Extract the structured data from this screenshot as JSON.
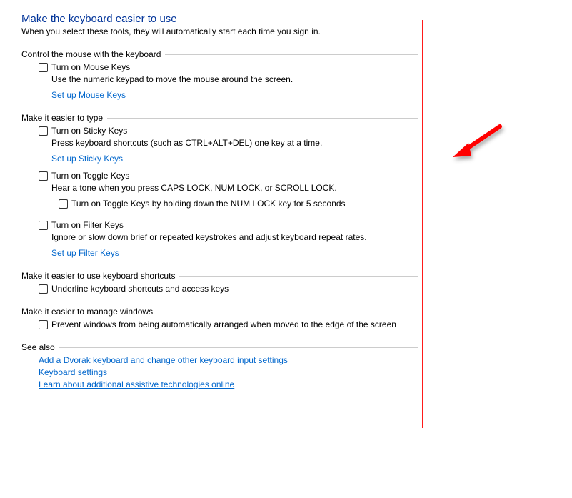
{
  "page": {
    "title": "Make the keyboard easier to use",
    "subtitle": "When you select these tools, they will automatically start each time you sign in."
  },
  "sections": {
    "mouse": {
      "header": "Control the mouse with the keyboard",
      "mouse_keys_label": "Turn on Mouse Keys",
      "mouse_keys_desc": "Use the numeric keypad to move the mouse around the screen.",
      "mouse_keys_link": "Set up Mouse Keys"
    },
    "type": {
      "header": "Make it easier to type",
      "sticky_label": "Turn on Sticky Keys",
      "sticky_desc": "Press keyboard shortcuts (such as CTRL+ALT+DEL) one key at a time.",
      "sticky_link": "Set up Sticky Keys",
      "toggle_label": "Turn on Toggle Keys",
      "toggle_desc": "Hear a tone when you press CAPS LOCK, NUM LOCK, or SCROLL LOCK.",
      "toggle_hold_label": "Turn on Toggle Keys by holding down the NUM LOCK key for 5 seconds",
      "filter_label": "Turn on Filter Keys",
      "filter_desc": "Ignore or slow down brief or repeated keystrokes and adjust keyboard repeat rates.",
      "filter_link": "Set up Filter Keys"
    },
    "shortcuts": {
      "header": "Make it easier to use keyboard shortcuts",
      "underline_label": "Underline keyboard shortcuts and access keys"
    },
    "windows": {
      "header": "Make it easier to manage windows",
      "prevent_arrange_label": "Prevent windows from being automatically arranged when moved to the edge of the screen"
    },
    "seealso": {
      "header": "See also",
      "dvorak_link": "Add a Dvorak keyboard and change other keyboard input settings",
      "keyboard_link": "Keyboard settings",
      "assistive_link": "Learn about additional assistive technologies online"
    }
  }
}
